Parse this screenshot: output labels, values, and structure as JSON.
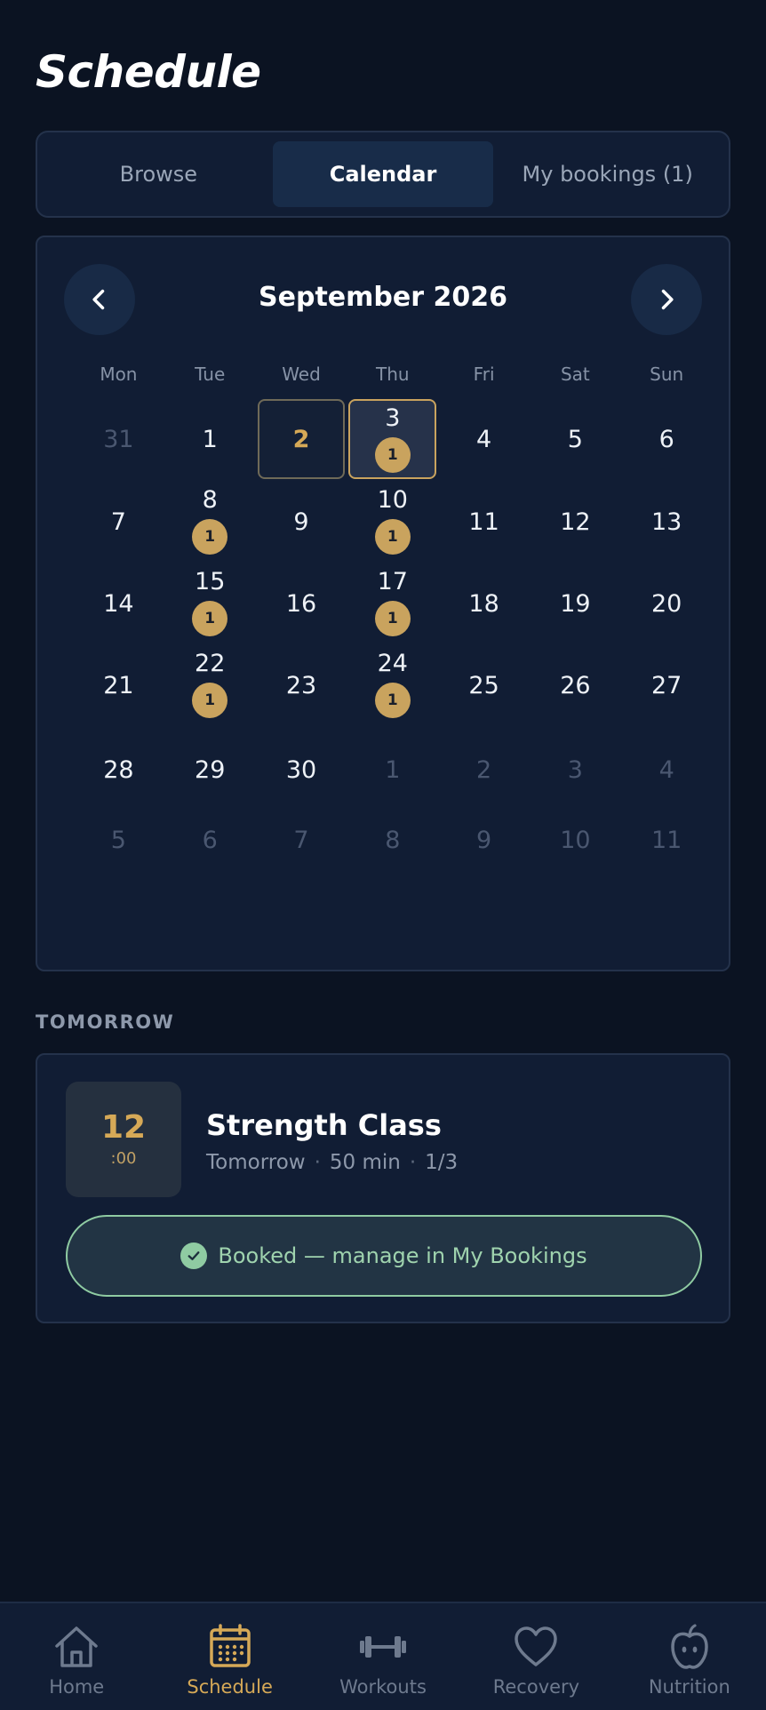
{
  "header": {
    "title": "Schedule"
  },
  "tabs": [
    {
      "label": "Browse",
      "active": false
    },
    {
      "label": "Calendar",
      "active": true
    },
    {
      "label": "My bookings (1)",
      "active": false
    }
  ],
  "calendar": {
    "month_label": "September 2026",
    "weekdays": [
      "Mon",
      "Tue",
      "Wed",
      "Thu",
      "Fri",
      "Sat",
      "Sun"
    ],
    "days": [
      {
        "d": "31",
        "muted": true
      },
      {
        "d": "1"
      },
      {
        "d": "2",
        "today": true
      },
      {
        "d": "3",
        "selected": true,
        "badge": "1"
      },
      {
        "d": "4"
      },
      {
        "d": "5"
      },
      {
        "d": "6"
      },
      {
        "d": "7"
      },
      {
        "d": "8",
        "badge": "1"
      },
      {
        "d": "9"
      },
      {
        "d": "10",
        "badge": "1"
      },
      {
        "d": "11"
      },
      {
        "d": "12"
      },
      {
        "d": "13"
      },
      {
        "d": "14"
      },
      {
        "d": "15",
        "badge": "1"
      },
      {
        "d": "16"
      },
      {
        "d": "17",
        "badge": "1"
      },
      {
        "d": "18"
      },
      {
        "d": "19"
      },
      {
        "d": "20"
      },
      {
        "d": "21"
      },
      {
        "d": "22",
        "badge": "1"
      },
      {
        "d": "23"
      },
      {
        "d": "24",
        "badge": "1"
      },
      {
        "d": "25"
      },
      {
        "d": "26"
      },
      {
        "d": "27"
      },
      {
        "d": "28"
      },
      {
        "d": "29"
      },
      {
        "d": "30"
      },
      {
        "d": "1",
        "muted": true
      },
      {
        "d": "2",
        "muted": true
      },
      {
        "d": "3",
        "muted": true
      },
      {
        "d": "4",
        "muted": true
      },
      {
        "d": "5",
        "muted": true
      },
      {
        "d": "6",
        "muted": true
      },
      {
        "d": "7",
        "muted": true
      },
      {
        "d": "8",
        "muted": true
      },
      {
        "d": "9",
        "muted": true
      },
      {
        "d": "10",
        "muted": true
      },
      {
        "d": "11",
        "muted": true
      }
    ]
  },
  "tomorrow": {
    "section_label": "TOMORROW",
    "event": {
      "hour": "12",
      "minutes": ":00",
      "title": "Strength Class",
      "meta": [
        "Tomorrow",
        "50 min",
        "1/3"
      ],
      "meta_separator": "·",
      "status_label": "Booked — manage in My Bookings"
    }
  },
  "bottom_nav": [
    {
      "label": "Home",
      "icon": "home-icon",
      "active": false
    },
    {
      "label": "Schedule",
      "icon": "calendar-icon",
      "active": true
    },
    {
      "label": "Workouts",
      "icon": "dumbbell-icon",
      "active": false
    },
    {
      "label": "Recovery",
      "icon": "heart-icon",
      "active": false
    },
    {
      "label": "Nutrition",
      "icon": "apple-icon",
      "active": false
    }
  ],
  "colors": {
    "background": "#0b1322",
    "card": "#111d34",
    "accent_gold": "#d6a957",
    "booked_green": "#8fcba2"
  }
}
